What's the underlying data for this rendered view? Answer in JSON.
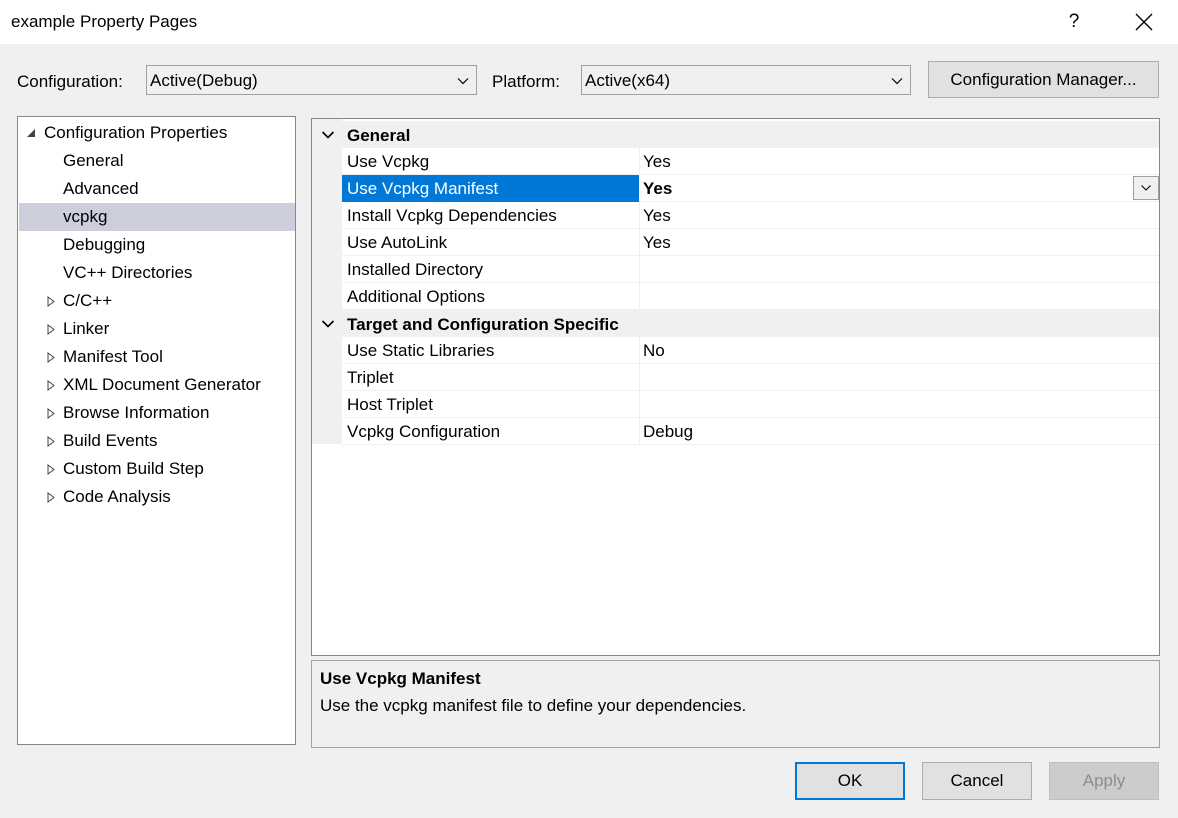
{
  "window": {
    "title": "example Property Pages",
    "help_label": "?"
  },
  "toolbar": {
    "configuration_label": "Configuration:",
    "configuration_value": "Active(Debug)",
    "platform_label": "Platform:",
    "platform_value": "Active(x64)",
    "config_manager_label": "Configuration Manager..."
  },
  "tree": {
    "items": [
      {
        "label": "Configuration Properties",
        "twisty": "expanded"
      },
      {
        "label": "General"
      },
      {
        "label": "Advanced"
      },
      {
        "label": "vcpkg",
        "selected": true
      },
      {
        "label": "Debugging"
      },
      {
        "label": "VC++ Directories"
      },
      {
        "label": "C/C++",
        "twisty": "collapsed"
      },
      {
        "label": "Linker",
        "twisty": "collapsed"
      },
      {
        "label": "Manifest Tool",
        "twisty": "collapsed"
      },
      {
        "label": "XML Document Generator",
        "twisty": "collapsed"
      },
      {
        "label": "Browse Information",
        "twisty": "collapsed"
      },
      {
        "label": "Build Events",
        "twisty": "collapsed"
      },
      {
        "label": "Custom Build Step",
        "twisty": "collapsed"
      },
      {
        "label": "Code Analysis",
        "twisty": "collapsed"
      }
    ]
  },
  "grid": {
    "categories": [
      {
        "name": "General",
        "properties": [
          {
            "name": "Use Vcpkg",
            "value": "Yes"
          },
          {
            "name": "Use Vcpkg Manifest",
            "value": "Yes",
            "selected": true
          },
          {
            "name": "Install Vcpkg Dependencies",
            "value": "Yes"
          },
          {
            "name": "Use AutoLink",
            "value": "Yes"
          },
          {
            "name": "Installed Directory",
            "value": ""
          },
          {
            "name": "Additional Options",
            "value": ""
          }
        ]
      },
      {
        "name": "Target and Configuration Specific",
        "properties": [
          {
            "name": "Use Static Libraries",
            "value": "No"
          },
          {
            "name": "Triplet",
            "value": ""
          },
          {
            "name": "Host Triplet",
            "value": ""
          },
          {
            "name": "Vcpkg Configuration",
            "value": "Debug"
          }
        ]
      }
    ]
  },
  "description": {
    "title": "Use Vcpkg Manifest",
    "text": "Use the vcpkg manifest file to define your dependencies."
  },
  "footer": {
    "ok_label": "OK",
    "cancel_label": "Cancel",
    "apply_label": "Apply"
  },
  "colors": {
    "selection_accent": "#0078d7",
    "tree_selection": "#cccedb",
    "default_button_border": "#0078d7",
    "disabled_text": "#8d8d8d"
  }
}
